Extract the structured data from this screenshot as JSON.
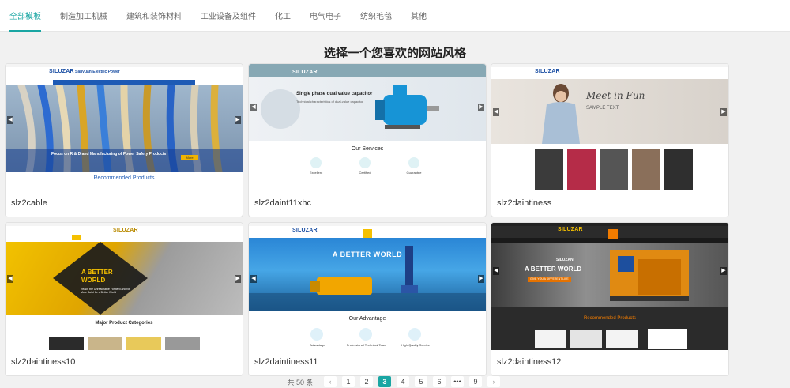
{
  "tabs": [
    "全部模板",
    "制造加工机械",
    "建筑和装饰材料",
    "工业设备及组件",
    "化工",
    "电气电子",
    "纺织毛毯",
    "其他"
  ],
  "heading": "选择一个您喜欢的网站风格",
  "colors": {
    "accent": "#1aa6a3"
  },
  "templates": [
    {
      "name": "slz2cable",
      "logo": "SILUZAR",
      "company": "Sanyuan Electric Power",
      "banner_text": "Focus on R & D and Manufacturing of Power Safety Products",
      "button": "More",
      "section_title": "Recommended Products"
    },
    {
      "name": "slz2daint11xhc",
      "logo": "SILUZAR",
      "banner_title": "Single phase dual value capacitor",
      "banner_sub": "Technical characteristics of dual-value capacitor",
      "section_title": "Our Services",
      "features": [
        "Excellent",
        "Certified",
        "Guarantee"
      ]
    },
    {
      "name": "slz2daintiness",
      "logo": "SILUZAR",
      "banner_script": "Meet in Fun",
      "banner_sub": "SAMPLE TEXT"
    },
    {
      "name": "slz2daintiness10",
      "logo": "SILUZAR",
      "banner_title": "A BETTER WORLD",
      "banner_sub": "Reach the Unreachable Forward and for More Build for a Better World",
      "section_title": "Major Product Categories"
    },
    {
      "name": "slz2daintiness11",
      "logo": "SILUZAR",
      "banner_title": "A BETTER WORLD",
      "section_title": "Our Advantage",
      "features": [
        "Advantage",
        "Professional Technical Team",
        "High Quality Service"
      ]
    },
    {
      "name": "slz2daintiness12",
      "logo": "SILUZAR",
      "banner_brand": "SILUZAN",
      "banner_title": "A BETTER WORLD",
      "banner_button": "GIVE YOU A DIFFERENT LIFE",
      "section_title": "Recommended Products"
    }
  ],
  "pagination": {
    "total": "共 50 条",
    "prev": "‹",
    "pages": [
      "1",
      "2",
      "3",
      "4",
      "5",
      "6",
      "•••",
      "9"
    ],
    "current": "3",
    "next": "›"
  }
}
